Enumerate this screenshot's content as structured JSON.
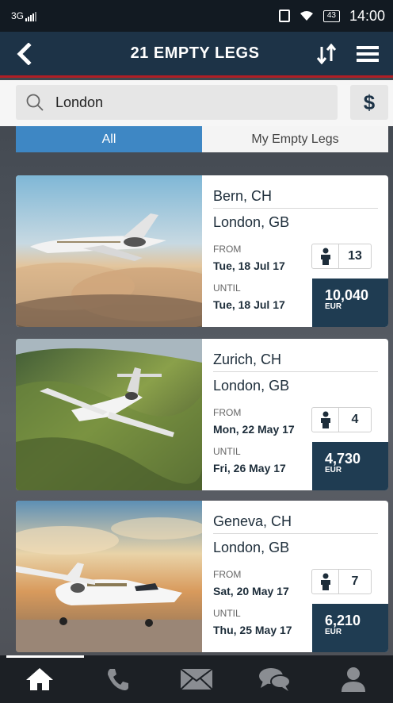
{
  "status_bar": {
    "network": "3G",
    "battery": "43",
    "time": "14:00"
  },
  "header": {
    "title": "21 EMPTY LEGS"
  },
  "search": {
    "value": "London",
    "currency_symbol": "$"
  },
  "tabs": [
    {
      "label": "All",
      "active": true
    },
    {
      "label": "My Empty Legs",
      "active": false
    }
  ],
  "legs": [
    {
      "origin": "Bern, CH",
      "destination": "London, GB",
      "from_label": "FROM",
      "from_date": "Tue, 18 Jul 17",
      "until_label": "UNTIL",
      "until_date": "Tue, 18 Jul 17",
      "seats": "13",
      "price": "10,040",
      "currency": "EUR"
    },
    {
      "origin": "Zurich, CH",
      "destination": "London, GB",
      "from_label": "FROM",
      "from_date": "Mon, 22 May 17",
      "until_label": "UNTIL",
      "until_date": "Fri, 26 May 17",
      "seats": "4",
      "price": "4,730",
      "currency": "EUR"
    },
    {
      "origin": "Geneva, CH",
      "destination": "London, GB",
      "from_label": "FROM",
      "from_date": "Sat, 20 May 17",
      "until_label": "UNTIL",
      "until_date": "Thu, 25 May 17",
      "seats": "7",
      "price": "6,210",
      "currency": "EUR"
    }
  ],
  "icons": {
    "back": "chevron-left-icon",
    "sort": "sort-icon",
    "menu": "hamburger-menu-icon",
    "search": "search-icon",
    "passengers": "person-icon",
    "nav": [
      "home-icon",
      "phone-icon",
      "mail-icon",
      "chat-icon",
      "user-icon"
    ]
  },
  "colors": {
    "header": "#1d3347",
    "accent_red": "#b01e25",
    "tab_active": "#3e87c4",
    "price_bg": "#1f3c52"
  }
}
